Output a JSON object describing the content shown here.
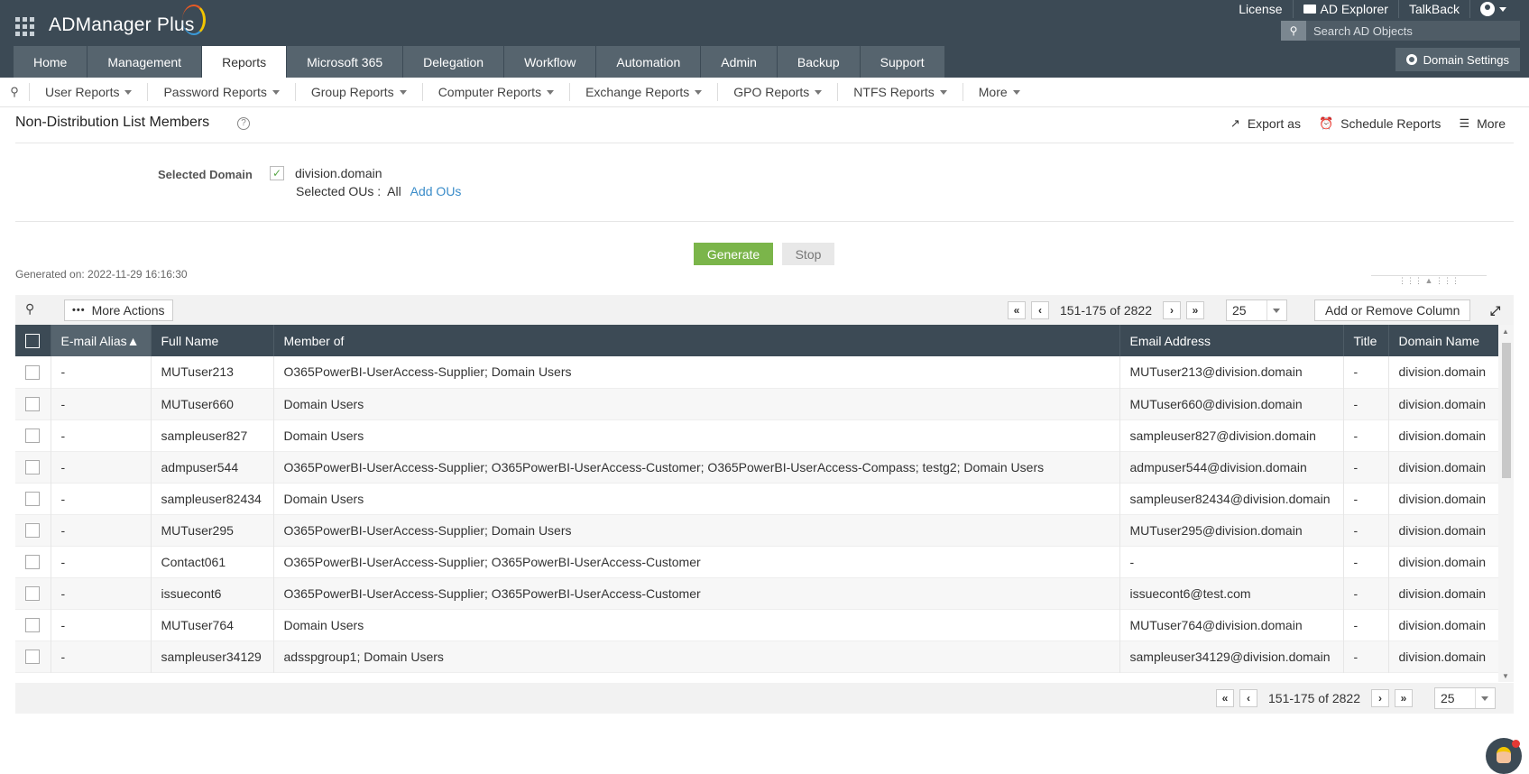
{
  "app": {
    "name": "ADManager Plus"
  },
  "toplinks": [
    "License",
    "AD Explorer",
    "TalkBack"
  ],
  "search": {
    "placeholder": "Search AD Objects"
  },
  "tabs": [
    "Home",
    "Management",
    "Reports",
    "Microsoft 365",
    "Delegation",
    "Workflow",
    "Automation",
    "Admin",
    "Backup",
    "Support"
  ],
  "active_tab": "Reports",
  "domain_settings": "Domain Settings",
  "subnav": [
    "User Reports",
    "Password Reports",
    "Group Reports",
    "Computer Reports",
    "Exchange Reports",
    "GPO Reports",
    "NTFS Reports",
    "More"
  ],
  "page": {
    "title": "Non-Distribution List Members",
    "export": "Export as",
    "schedule": "Schedule Reports",
    "more": "More",
    "selected_domain_label": "Selected Domain",
    "domain": "division.domain",
    "selected_ous_label": "Selected OUs :",
    "selected_ous_value": "All",
    "add_ous": "Add OUs",
    "generate": "Generate",
    "stop": "Stop",
    "generated_on": "Generated on: 2022-11-29 16:16:30"
  },
  "toolbar": {
    "more_actions": "More Actions",
    "range": "151-175 of 2822",
    "page_size": "25",
    "add_remove_column": "Add or Remove Column"
  },
  "table": {
    "columns": [
      "E-mail Alias",
      "Full Name",
      "Member of",
      "Email Address",
      "Title",
      "Domain Name"
    ],
    "rows": [
      [
        "-",
        "MUTuser213",
        "O365PowerBI-UserAccess-Supplier; Domain Users",
        "MUTuser213@division.domain",
        "-",
        "division.domain"
      ],
      [
        "-",
        "MUTuser660",
        "Domain Users",
        "MUTuser660@division.domain",
        "-",
        "division.domain"
      ],
      [
        "-",
        "sampleuser827",
        "Domain Users",
        "sampleuser827@division.domain",
        "-",
        "division.domain"
      ],
      [
        "-",
        "admpuser544",
        "O365PowerBI-UserAccess-Supplier; O365PowerBI-UserAccess-Customer; O365PowerBI-UserAccess-Compass; testg2; Domain Users",
        "admpuser544@division.domain",
        "-",
        "division.domain"
      ],
      [
        "-",
        "sampleuser82434",
        "Domain Users",
        "sampleuser82434@division.domain",
        "-",
        "division.domain"
      ],
      [
        "-",
        "MUTuser295",
        "O365PowerBI-UserAccess-Supplier; Domain Users",
        "MUTuser295@division.domain",
        "-",
        "division.domain"
      ],
      [
        "-",
        "Contact061",
        "O365PowerBI-UserAccess-Supplier; O365PowerBI-UserAccess-Customer",
        "-",
        "-",
        "division.domain"
      ],
      [
        "-",
        "issuecont6",
        "O365PowerBI-UserAccess-Supplier; O365PowerBI-UserAccess-Customer",
        "issuecont6@test.com",
        "-",
        "division.domain"
      ],
      [
        "-",
        "MUTuser764",
        "Domain Users",
        "MUTuser764@division.domain",
        "-",
        "division.domain"
      ],
      [
        "-",
        "sampleuser34129",
        "adsspgroup1; Domain Users",
        "sampleuser34129@division.domain",
        "-",
        "division.domain"
      ]
    ]
  }
}
